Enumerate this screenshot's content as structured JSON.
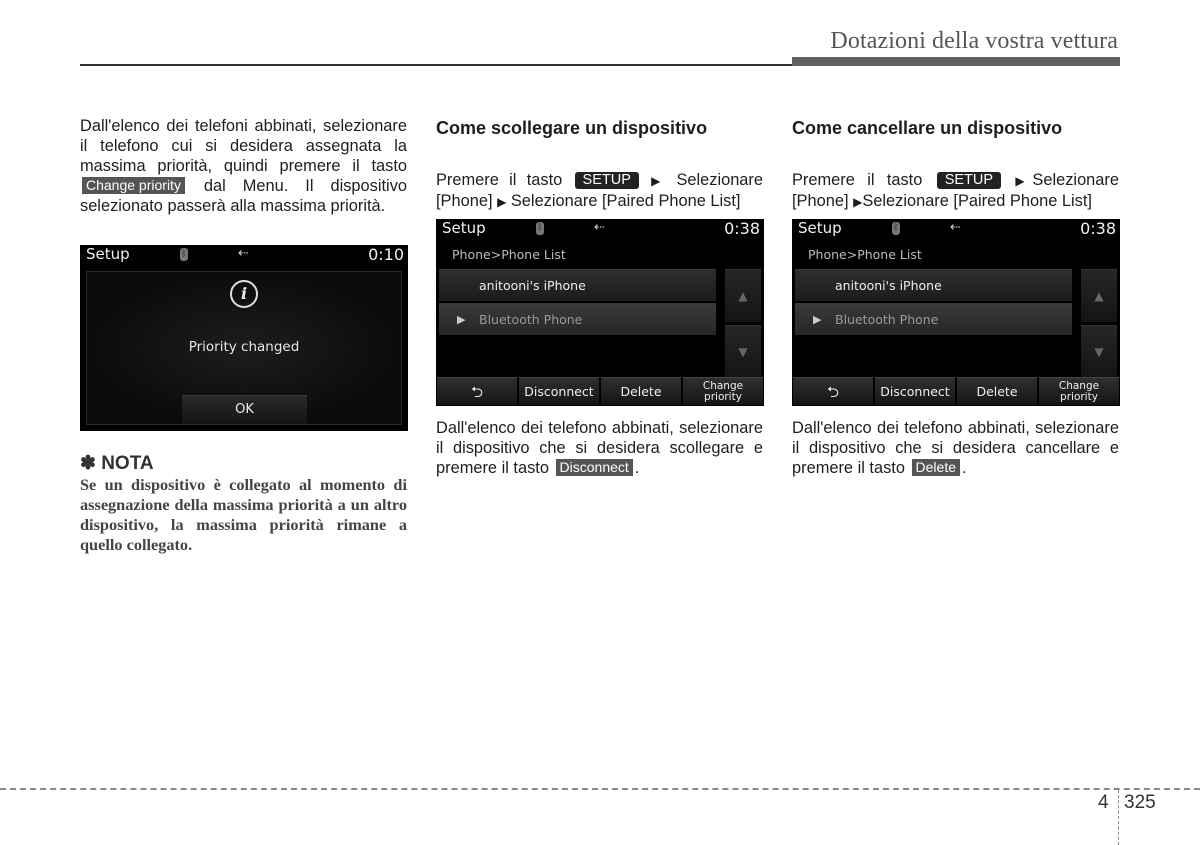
{
  "header": {
    "title": "Dotazioni della vostra vettura"
  },
  "col1": {
    "para": {
      "before": "Dall'elenco dei telefoni abbinati, selezionare il telefono cui si desidera assegnata la massima priorità, quindi premere il tasto",
      "key": "Change priority",
      "after": "dal Menu. Il dispositivo selezionato passerà alla",
      "last": "massima priorità."
    },
    "screen": {
      "title": "Setup",
      "time": "0:10",
      "info_glyph": "i",
      "message": "Priority changed",
      "ok": "OK"
    },
    "nota": {
      "star": "✽",
      "title": "NOTA",
      "body": "Se un dispositivo è collegato al momento di assegnazione della massima priorità a un altro dispositivo, la massima priorità rimane a quello collegato."
    }
  },
  "col2": {
    "heading": "Come scollegare un dispositivo",
    "nav": {
      "pre": "Premere il tasto",
      "key": "SETUP",
      "step1": "Selezionare [Phone]",
      "step2": "Selezionare [Paired Phone List]"
    },
    "screen": {
      "title": "Setup",
      "time": "0:38",
      "breadcrumb": "Phone>Phone List",
      "items": [
        "anitooni's iPhone",
        "Bluetooth Phone"
      ],
      "buttons": {
        "back": "⮌",
        "disconnect": "Disconnect",
        "delete": "Delete",
        "change1": "Change",
        "change2": "priority"
      }
    },
    "para": {
      "line1": "Dall'elenco dei telefono abbinati, selezionare il dispositivo che si desidera",
      "before": "scollegare e premere il tasto",
      "key": "Disconnect",
      "after": "."
    }
  },
  "col3": {
    "heading": "Come cancellare un dispositivo",
    "nav": {
      "pre": "Premere il tasto",
      "key": "SETUP",
      "step1": "Selezionare [Phone]",
      "step2": "Selezionare [Paired Phone List]"
    },
    "screen": {
      "title": "Setup",
      "time": "0:38",
      "breadcrumb": "Phone>Phone List",
      "items": [
        "anitooni's iPhone",
        "Bluetooth Phone"
      ],
      "buttons": {
        "back": "⮌",
        "disconnect": "Disconnect",
        "delete": "Delete",
        "change1": "Change",
        "change2": "priority"
      }
    },
    "para": {
      "line1": "Dall'elenco dei telefono abbinati, selezionare il dispositivo che si desidera",
      "before": "cancellare e premere il tasto",
      "key": "Delete",
      "after": "."
    }
  },
  "footer": {
    "chapter": "4",
    "page": "325"
  },
  "icons": {
    "arrow": "▶",
    "up": "▲",
    "down": "▼",
    "usb": "⭠",
    "bt": "ᛒ"
  }
}
